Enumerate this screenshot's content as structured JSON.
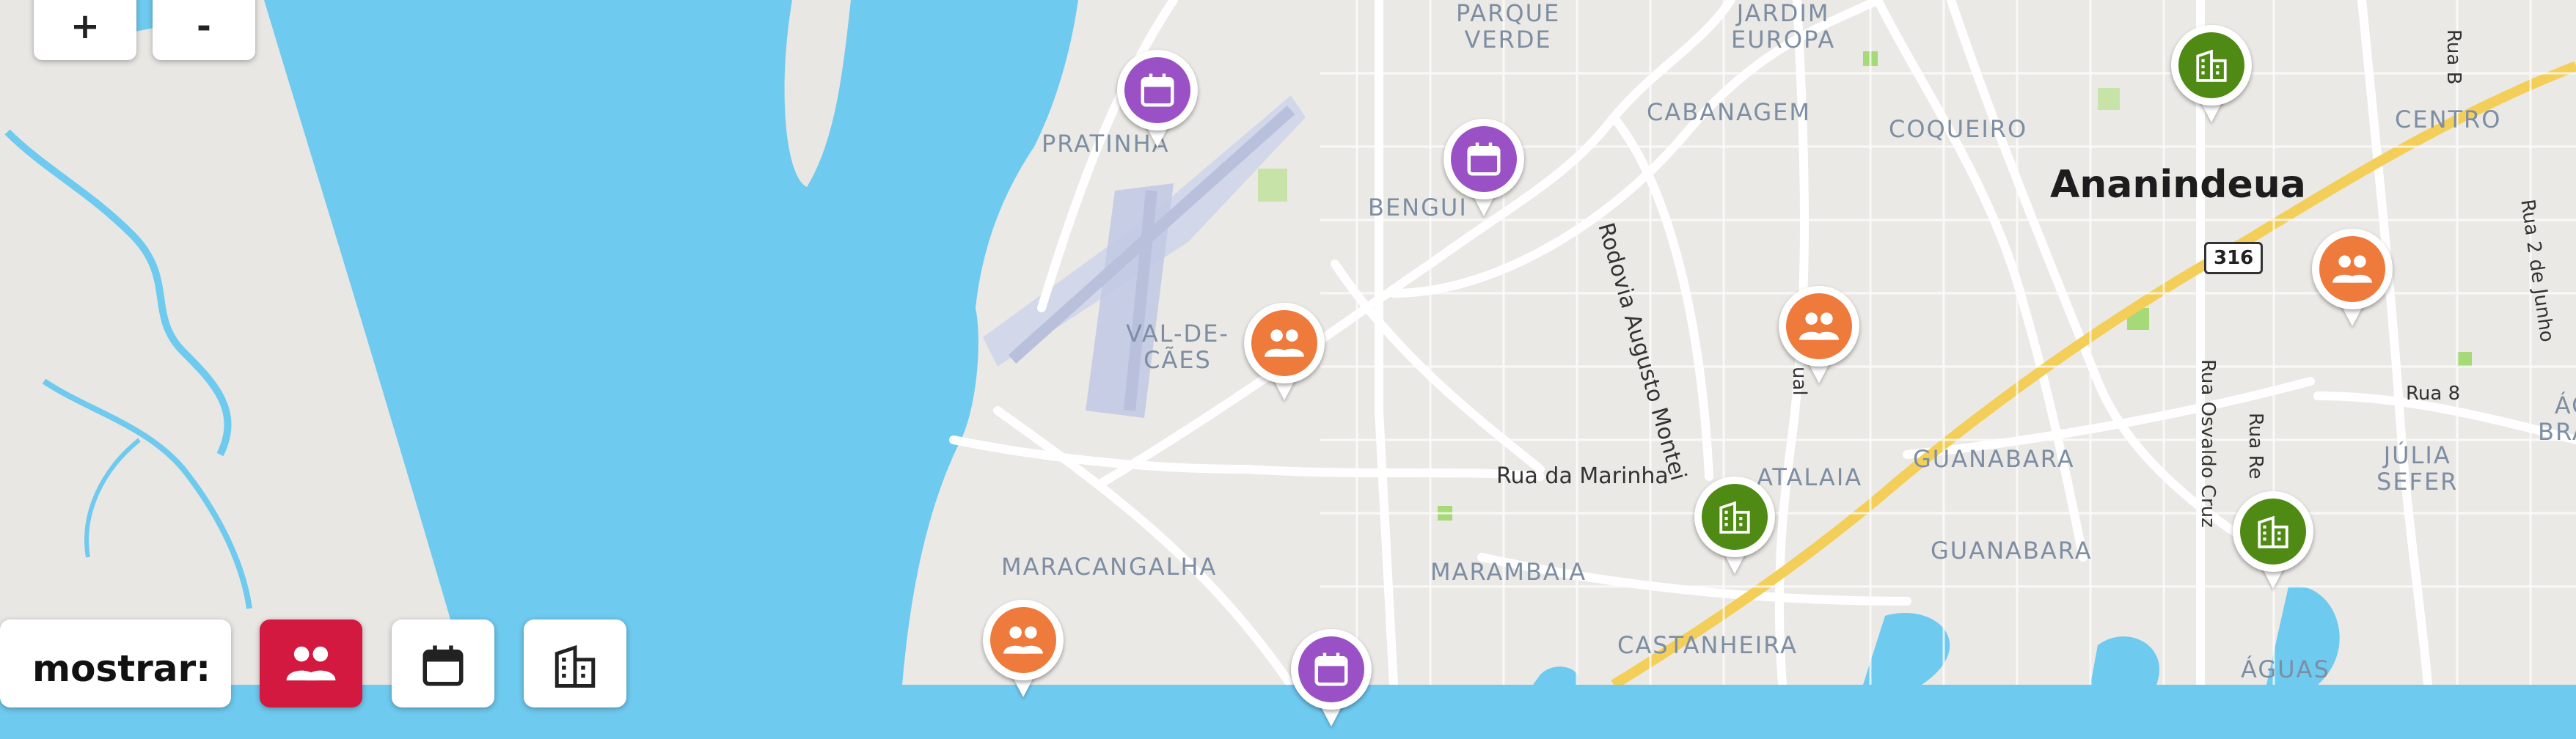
{
  "zoom": {
    "in_label": "+",
    "out_label": "-"
  },
  "filter": {
    "label": "mostrar:",
    "options": [
      {
        "name": "people",
        "active": true
      },
      {
        "name": "calendar",
        "active": false
      },
      {
        "name": "building",
        "active": false
      }
    ]
  },
  "colors": {
    "water": "#6fcaef",
    "land": "#e9e7e3",
    "event": "#9b51c6",
    "group": "#ee7a3c",
    "place": "#4f8a14",
    "filter_active": "#d3193f"
  },
  "map": {
    "districts": {
      "parque_verde": "PARQUE\nVERDE",
      "jardim_europa": "JARDIM\nEUROPA",
      "cabanagem": "CABANAGEM",
      "coqueiro": "COQUEIRO",
      "centro": "CENTRO",
      "pratinha": "PRATINHA",
      "bengui": "BENGUI",
      "val_de_caes": "VAL-DE-\nCÃES",
      "maracangalha": "MARACANGALHA",
      "marambaia": "MARAMBAIA",
      "atalaia": "ATALAIA",
      "guanabara_1": "GUANABARA",
      "guanabara_2": "GUANABARA",
      "julia_sefer": "JÚLIA\nSEFER",
      "agua_branca": "ÁGUA\nBRANCA",
      "castanheira": "CASTANHEIRA",
      "aguas": "ÁGUAS"
    },
    "city": "Ananindeua",
    "streets": {
      "rodovia_augusto": "Rodovia Augusto Montei",
      "rua_marinha": "Rua da Marinha",
      "rua_b": "Rua B",
      "rua_2_junho": "Rua 2 de Junho",
      "rua_8": "Rua 8",
      "rua_osvaldo_cruz": "Rua Osvaldo Cruz",
      "rua_re": "Rua Re",
      "rua_al": "ual"
    },
    "highway_shield": "316"
  },
  "markers": [
    {
      "type": "event"
    },
    {
      "type": "event"
    },
    {
      "type": "event"
    },
    {
      "type": "group"
    },
    {
      "type": "group"
    },
    {
      "type": "group"
    },
    {
      "type": "group"
    },
    {
      "type": "place"
    },
    {
      "type": "place"
    },
    {
      "type": "place"
    }
  ]
}
